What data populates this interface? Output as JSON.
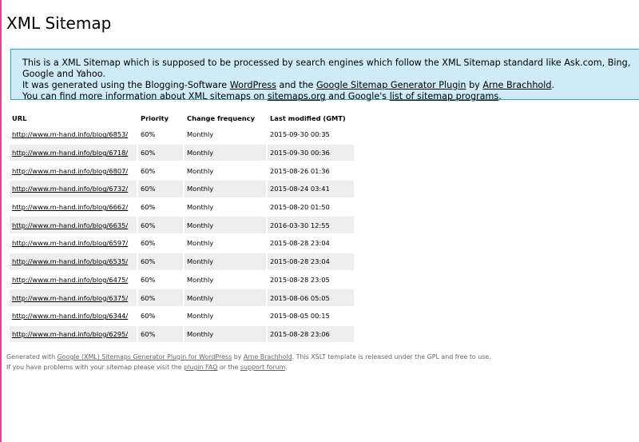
{
  "title": "XML Sitemap",
  "intro": {
    "line1": "This is a XML Sitemap which is supposed to be processed by search engines which follow the XML Sitemap standard like Ask.com, Bing, Google and Yahoo.",
    "line2_pre": "It was generated using the Blogging-Software ",
    "line2_link1": "WordPress",
    "line2_mid": " and the ",
    "line2_link2": "Google Sitemap Generator Plugin",
    "line2_by": " by ",
    "line2_link3": "Arne Brachhold",
    "line2_end": ".",
    "line3_pre": "You can find more information about XML sitemaps on ",
    "line3_link1": "sitemaps.org",
    "line3_mid": " and Google's ",
    "line3_link2": "list of sitemap programs",
    "line3_end": "."
  },
  "table": {
    "headers": {
      "url": "URL",
      "priority": "Priority",
      "change": "Change frequency",
      "modified": "Last modified (GMT)"
    },
    "rows": [
      {
        "url": "http://www.m-hand.info/blog/6853/",
        "priority": "60%",
        "change": "Monthly",
        "modified": "2015-09-30 00:35"
      },
      {
        "url": "http://www.m-hand.info/blog/6718/",
        "priority": "60%",
        "change": "Monthly",
        "modified": "2015-09-30 00:36"
      },
      {
        "url": "http://www.m-hand.info/blog/6807/",
        "priority": "60%",
        "change": "Monthly",
        "modified": "2015-08-26 01:36"
      },
      {
        "url": "http://www.m-hand.info/blog/6732/",
        "priority": "60%",
        "change": "Monthly",
        "modified": "2015-08-24 03:41"
      },
      {
        "url": "http://www.m-hand.info/blog/6662/",
        "priority": "60%",
        "change": "Monthly",
        "modified": "2015-08-20 01:50"
      },
      {
        "url": "http://www.m-hand.info/blog/6635/",
        "priority": "60%",
        "change": "Monthly",
        "modified": "2016-03-30 12:55"
      },
      {
        "url": "http://www.m-hand.info/blog/6597/",
        "priority": "60%",
        "change": "Monthly",
        "modified": "2015-08-28 23:04"
      },
      {
        "url": "http://www.m-hand.info/blog/6535/",
        "priority": "60%",
        "change": "Monthly",
        "modified": "2015-08-28 23:04"
      },
      {
        "url": "http://www.m-hand.info/blog/6475/",
        "priority": "60%",
        "change": "Monthly",
        "modified": "2015-08-28 23:05"
      },
      {
        "url": "http://www.m-hand.info/blog/6375/",
        "priority": "60%",
        "change": "Monthly",
        "modified": "2015-08-06 05:05"
      },
      {
        "url": "http://www.m-hand.info/blog/6344/",
        "priority": "60%",
        "change": "Monthly",
        "modified": "2015-08-05 00:15"
      },
      {
        "url": "http://www.m-hand.info/blog/6295/",
        "priority": "60%",
        "change": "Monthly",
        "modified": "2015-08-28 23:06"
      }
    ]
  },
  "footer": {
    "l1_pre": "Generated with ",
    "l1_link1": "Google (XML) Sitemaps Generator Plugin for WordPress",
    "l1_by": " by ",
    "l1_link2": "Arne Brachhold",
    "l1_end": ". This XSLT template is released under the GPL and free to use.",
    "l2_pre": "If you have problems with your sitemap please visit the ",
    "l2_link1": "plugin FAQ",
    "l2_mid": " or the ",
    "l2_link2": "support forum",
    "l2_end": "."
  },
  "colors": {
    "accent_border": "#d04a9a",
    "info_bg": "#cfebf7",
    "info_border": "#2aa4d4",
    "row_stripe": "#eeeeee"
  }
}
